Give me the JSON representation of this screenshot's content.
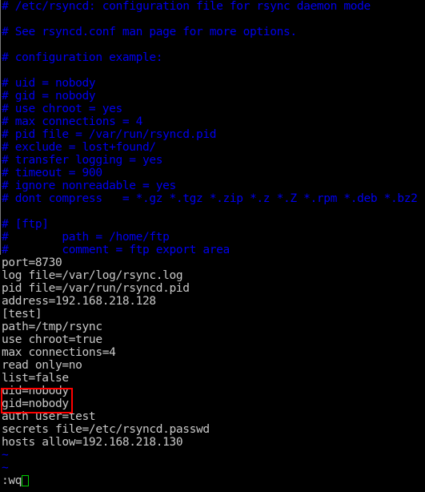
{
  "terminal": {
    "background_color": "#000000",
    "comment_color": "#0000ee",
    "text_color": "#c8c8c8",
    "annotation_color": "#ff0000",
    "cursor_color": "#00cc00"
  },
  "editor": {
    "name": "vim",
    "command_line": ":wq",
    "cursor_glyph": "block-cursor"
  },
  "lines": [
    {
      "type": "comment",
      "text": "# /etc/rsyncd: configuration file for rsync daemon mode"
    },
    {
      "type": "comment",
      "text": ""
    },
    {
      "type": "comment",
      "text": "# See rsyncd.conf man page for more options."
    },
    {
      "type": "comment",
      "text": ""
    },
    {
      "type": "comment",
      "text": "# configuration example:"
    },
    {
      "type": "comment",
      "text": ""
    },
    {
      "type": "comment",
      "text": "# uid = nobody"
    },
    {
      "type": "comment",
      "text": "# gid = nobody"
    },
    {
      "type": "comment",
      "text": "# use chroot = yes"
    },
    {
      "type": "comment",
      "text": "# max connections = 4"
    },
    {
      "type": "comment",
      "text": "# pid file = /var/run/rsyncd.pid"
    },
    {
      "type": "comment",
      "text": "# exclude = lost+found/"
    },
    {
      "type": "comment",
      "text": "# transfer logging = yes"
    },
    {
      "type": "comment",
      "text": "# timeout = 900"
    },
    {
      "type": "comment",
      "text": "# ignore nonreadable = yes"
    },
    {
      "type": "comment",
      "text": "# dont compress   = *.gz *.tgz *.zip *.z *.Z *.rpm *.deb *.bz2"
    },
    {
      "type": "comment",
      "text": ""
    },
    {
      "type": "comment",
      "text": "# [ftp]"
    },
    {
      "type": "comment",
      "text": "#        path = /home/ftp"
    },
    {
      "type": "comment",
      "text": "#        comment = ftp export area"
    },
    {
      "type": "text",
      "text": "port=8730"
    },
    {
      "type": "text",
      "text": "log file=/var/log/rsync.log"
    },
    {
      "type": "text",
      "text": "pid file=/var/run/rsyncd.pid"
    },
    {
      "type": "text",
      "text": "address=192.168.218.128"
    },
    {
      "type": "text",
      "text": "[test]"
    },
    {
      "type": "text",
      "text": "path=/tmp/rsync"
    },
    {
      "type": "text",
      "text": "use chroot=true"
    },
    {
      "type": "text",
      "text": "max connections=4"
    },
    {
      "type": "text",
      "text": "read only=no"
    },
    {
      "type": "text",
      "text": "list=false"
    },
    {
      "type": "text",
      "text": "uid=nobody"
    },
    {
      "type": "text",
      "text": "gid=nobody"
    },
    {
      "type": "text",
      "text": "auth user=test"
    },
    {
      "type": "text",
      "text": "secrets file=/etc/rsyncd.passwd"
    },
    {
      "type": "text",
      "text": "hosts allow=192.168.218.130"
    },
    {
      "type": "tilde",
      "text": "~"
    },
    {
      "type": "tilde",
      "text": "~"
    }
  ],
  "annotation": {
    "label": "uid-gid-highlight",
    "highlighted_lines": [
      "uid=nobody",
      "gid=nobody"
    ]
  }
}
